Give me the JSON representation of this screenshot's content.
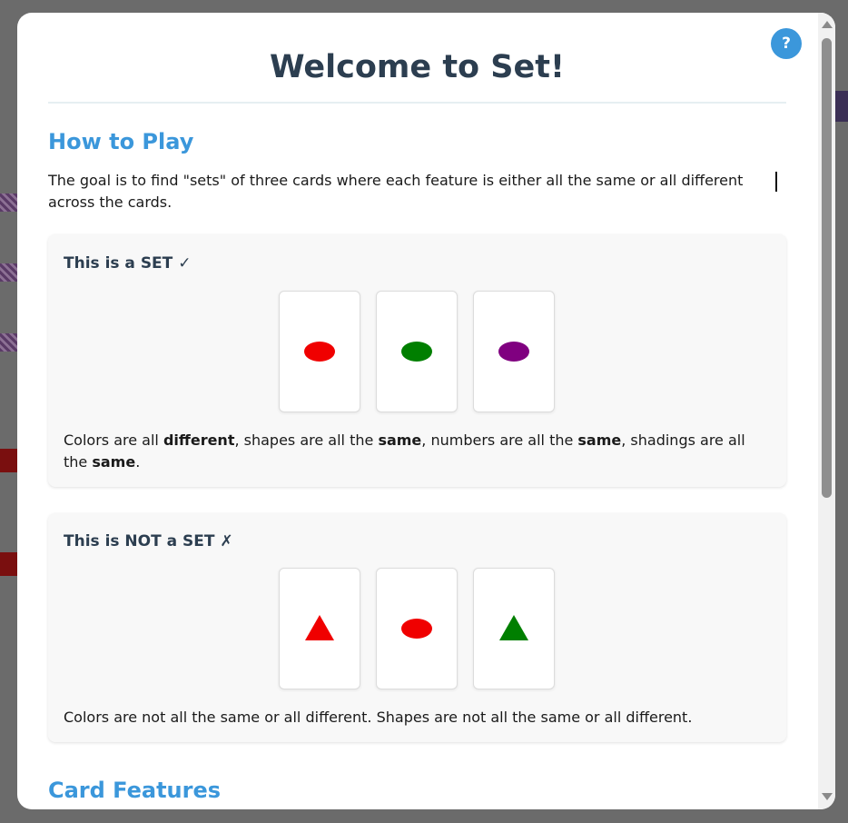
{
  "modal": {
    "title": "Welcome to Set!",
    "help_label": "?"
  },
  "how_to_play": {
    "heading": "How to Play",
    "intro": "The goal is to find \"sets\" of three cards where each feature is either all the same or all different across the cards."
  },
  "examples": [
    {
      "title": "This is a SET ✓",
      "cards": [
        {
          "shape": "oval",
          "color": "#f00000"
        },
        {
          "shape": "oval",
          "color": "#007f00"
        },
        {
          "shape": "oval",
          "color": "#800080"
        }
      ],
      "caption_parts": [
        {
          "text": "Colors are all ",
          "bold": false
        },
        {
          "text": "different",
          "bold": true
        },
        {
          "text": ", shapes are all the ",
          "bold": false
        },
        {
          "text": "same",
          "bold": true
        },
        {
          "text": ", numbers are all the ",
          "bold": false
        },
        {
          "text": "same",
          "bold": true
        },
        {
          "text": ", shadings are all the ",
          "bold": false
        },
        {
          "text": "same",
          "bold": true
        },
        {
          "text": ".",
          "bold": false
        }
      ]
    },
    {
      "title": "This is NOT a SET ✗",
      "cards": [
        {
          "shape": "triangle",
          "color": "#f00000"
        },
        {
          "shape": "oval",
          "color": "#f00000"
        },
        {
          "shape": "triangle",
          "color": "#007f00"
        }
      ],
      "caption": "Colors are not all the same or all different. Shapes are not all the same or all different."
    }
  ],
  "card_features": {
    "heading": "Card Features"
  },
  "colors": {
    "title": "#2c3e50",
    "heading": "#3b97db",
    "help_button": "#3b97db"
  }
}
